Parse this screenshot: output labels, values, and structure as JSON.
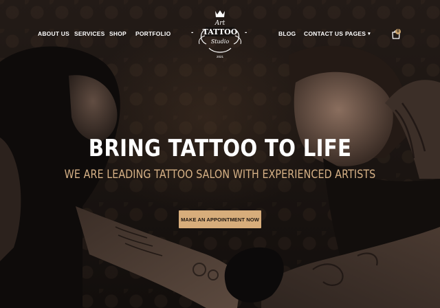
{
  "nav": {
    "left": [
      "ABOUT US",
      "SERVICES",
      "SHOP",
      "PORTFOLIO"
    ],
    "right": [
      "BLOG",
      "CONTACT US",
      "PAGES"
    ],
    "cart_count": "0"
  },
  "logo": {
    "top_script": "Art",
    "main": "TATTOO",
    "bottom_script": "Studio",
    "year": "2021"
  },
  "hero": {
    "title": "BRING TATTOO TO LIFE",
    "subtitle": "WE ARE LEADING TATTOO SALON WITH EXPERIENCED ARTISTS",
    "cta_label": "MAKE AN APPOINTMENT NOW"
  },
  "icons": {
    "cart": "shopping-bag-icon",
    "dropdown": "chevron-down-icon",
    "logo_crown": "crown-icon"
  },
  "colors": {
    "accent": "#d7ad7b",
    "subtitle": "#d6b186",
    "background": "#171311",
    "text": "#ffffff"
  }
}
